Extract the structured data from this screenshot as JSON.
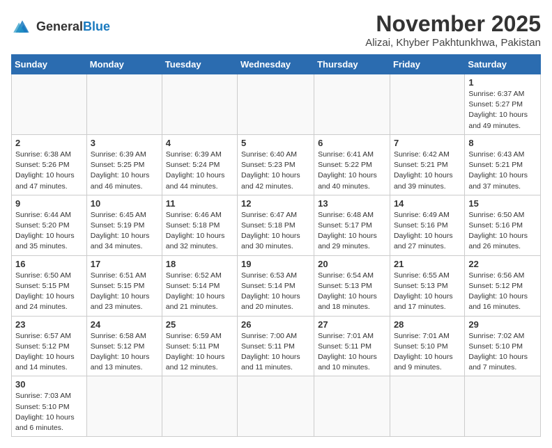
{
  "header": {
    "logo_general": "General",
    "logo_blue": "Blue",
    "month": "November 2025",
    "location": "Alizai, Khyber Pakhtunkhwa, Pakistan"
  },
  "weekdays": [
    "Sunday",
    "Monday",
    "Tuesday",
    "Wednesday",
    "Thursday",
    "Friday",
    "Saturday"
  ],
  "weeks": [
    [
      {
        "day": "",
        "info": ""
      },
      {
        "day": "",
        "info": ""
      },
      {
        "day": "",
        "info": ""
      },
      {
        "day": "",
        "info": ""
      },
      {
        "day": "",
        "info": ""
      },
      {
        "day": "",
        "info": ""
      },
      {
        "day": "1",
        "info": "Sunrise: 6:37 AM\nSunset: 5:27 PM\nDaylight: 10 hours and 49 minutes."
      }
    ],
    [
      {
        "day": "2",
        "info": "Sunrise: 6:38 AM\nSunset: 5:26 PM\nDaylight: 10 hours and 47 minutes."
      },
      {
        "day": "3",
        "info": "Sunrise: 6:39 AM\nSunset: 5:25 PM\nDaylight: 10 hours and 46 minutes."
      },
      {
        "day": "4",
        "info": "Sunrise: 6:39 AM\nSunset: 5:24 PM\nDaylight: 10 hours and 44 minutes."
      },
      {
        "day": "5",
        "info": "Sunrise: 6:40 AM\nSunset: 5:23 PM\nDaylight: 10 hours and 42 minutes."
      },
      {
        "day": "6",
        "info": "Sunrise: 6:41 AM\nSunset: 5:22 PM\nDaylight: 10 hours and 40 minutes."
      },
      {
        "day": "7",
        "info": "Sunrise: 6:42 AM\nSunset: 5:21 PM\nDaylight: 10 hours and 39 minutes."
      },
      {
        "day": "8",
        "info": "Sunrise: 6:43 AM\nSunset: 5:21 PM\nDaylight: 10 hours and 37 minutes."
      }
    ],
    [
      {
        "day": "9",
        "info": "Sunrise: 6:44 AM\nSunset: 5:20 PM\nDaylight: 10 hours and 35 minutes."
      },
      {
        "day": "10",
        "info": "Sunrise: 6:45 AM\nSunset: 5:19 PM\nDaylight: 10 hours and 34 minutes."
      },
      {
        "day": "11",
        "info": "Sunrise: 6:46 AM\nSunset: 5:18 PM\nDaylight: 10 hours and 32 minutes."
      },
      {
        "day": "12",
        "info": "Sunrise: 6:47 AM\nSunset: 5:18 PM\nDaylight: 10 hours and 30 minutes."
      },
      {
        "day": "13",
        "info": "Sunrise: 6:48 AM\nSunset: 5:17 PM\nDaylight: 10 hours and 29 minutes."
      },
      {
        "day": "14",
        "info": "Sunrise: 6:49 AM\nSunset: 5:16 PM\nDaylight: 10 hours and 27 minutes."
      },
      {
        "day": "15",
        "info": "Sunrise: 6:50 AM\nSunset: 5:16 PM\nDaylight: 10 hours and 26 minutes."
      }
    ],
    [
      {
        "day": "16",
        "info": "Sunrise: 6:50 AM\nSunset: 5:15 PM\nDaylight: 10 hours and 24 minutes."
      },
      {
        "day": "17",
        "info": "Sunrise: 6:51 AM\nSunset: 5:15 PM\nDaylight: 10 hours and 23 minutes."
      },
      {
        "day": "18",
        "info": "Sunrise: 6:52 AM\nSunset: 5:14 PM\nDaylight: 10 hours and 21 minutes."
      },
      {
        "day": "19",
        "info": "Sunrise: 6:53 AM\nSunset: 5:14 PM\nDaylight: 10 hours and 20 minutes."
      },
      {
        "day": "20",
        "info": "Sunrise: 6:54 AM\nSunset: 5:13 PM\nDaylight: 10 hours and 18 minutes."
      },
      {
        "day": "21",
        "info": "Sunrise: 6:55 AM\nSunset: 5:13 PM\nDaylight: 10 hours and 17 minutes."
      },
      {
        "day": "22",
        "info": "Sunrise: 6:56 AM\nSunset: 5:12 PM\nDaylight: 10 hours and 16 minutes."
      }
    ],
    [
      {
        "day": "23",
        "info": "Sunrise: 6:57 AM\nSunset: 5:12 PM\nDaylight: 10 hours and 14 minutes."
      },
      {
        "day": "24",
        "info": "Sunrise: 6:58 AM\nSunset: 5:12 PM\nDaylight: 10 hours and 13 minutes."
      },
      {
        "day": "25",
        "info": "Sunrise: 6:59 AM\nSunset: 5:11 PM\nDaylight: 10 hours and 12 minutes."
      },
      {
        "day": "26",
        "info": "Sunrise: 7:00 AM\nSunset: 5:11 PM\nDaylight: 10 hours and 11 minutes."
      },
      {
        "day": "27",
        "info": "Sunrise: 7:01 AM\nSunset: 5:11 PM\nDaylight: 10 hours and 10 minutes."
      },
      {
        "day": "28",
        "info": "Sunrise: 7:01 AM\nSunset: 5:10 PM\nDaylight: 10 hours and 9 minutes."
      },
      {
        "day": "29",
        "info": "Sunrise: 7:02 AM\nSunset: 5:10 PM\nDaylight: 10 hours and 7 minutes."
      }
    ],
    [
      {
        "day": "30",
        "info": "Sunrise: 7:03 AM\nSunset: 5:10 PM\nDaylight: 10 hours and 6 minutes."
      },
      {
        "day": "",
        "info": ""
      },
      {
        "day": "",
        "info": ""
      },
      {
        "day": "",
        "info": ""
      },
      {
        "day": "",
        "info": ""
      },
      {
        "day": "",
        "info": ""
      },
      {
        "day": "",
        "info": ""
      }
    ]
  ]
}
